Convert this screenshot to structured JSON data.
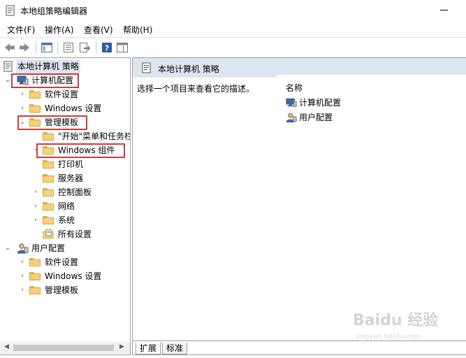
{
  "window": {
    "title": "本地组策略编辑器",
    "icons": {
      "app": "policy-editor-icon",
      "minimize": "minimize-icon"
    }
  },
  "menu": [
    "文件(F)",
    "操作(A)",
    "查看(V)",
    "帮助(H)"
  ],
  "toolbar": {
    "icons": [
      "back-arrow-icon",
      "forward-arrow-icon",
      "show-tree-icon",
      "properties-icon",
      "export-list-icon",
      "help-icon",
      "show-pane-icon"
    ]
  },
  "tree": {
    "root": "本地计算机 策略",
    "computer_config": "计算机配置",
    "cc_software": "软件设置",
    "cc_windows": "Windows 设置",
    "cc_admin": "管理模板",
    "cc_admin_start": "\"开始\"菜单和任务栏",
    "cc_admin_wincomp": "Windows 组件",
    "cc_admin_printer": "打印机",
    "cc_admin_server": "服务器",
    "cc_admin_control": "控制面板",
    "cc_admin_network": "网络",
    "cc_admin_system": "系统",
    "cc_admin_all": "所有设置",
    "user_config": "用户配置",
    "uc_software": "软件设置",
    "uc_windows": "Windows 设置",
    "uc_admin": "管理模板"
  },
  "right": {
    "header": "本地计算机 策略",
    "description": "选择一个项目来查看它的描述。",
    "column_name": "名称",
    "items": [
      "计算机配置",
      "用户配置"
    ],
    "tabs": [
      "扩展",
      "标准"
    ]
  },
  "watermark": {
    "text": "Baidu 经验",
    "url": "jingyan.baidu.com"
  },
  "colors": {
    "highlight": "#d03b3b",
    "header_bg": "#dde6f0",
    "folder": "#f4d17c"
  }
}
